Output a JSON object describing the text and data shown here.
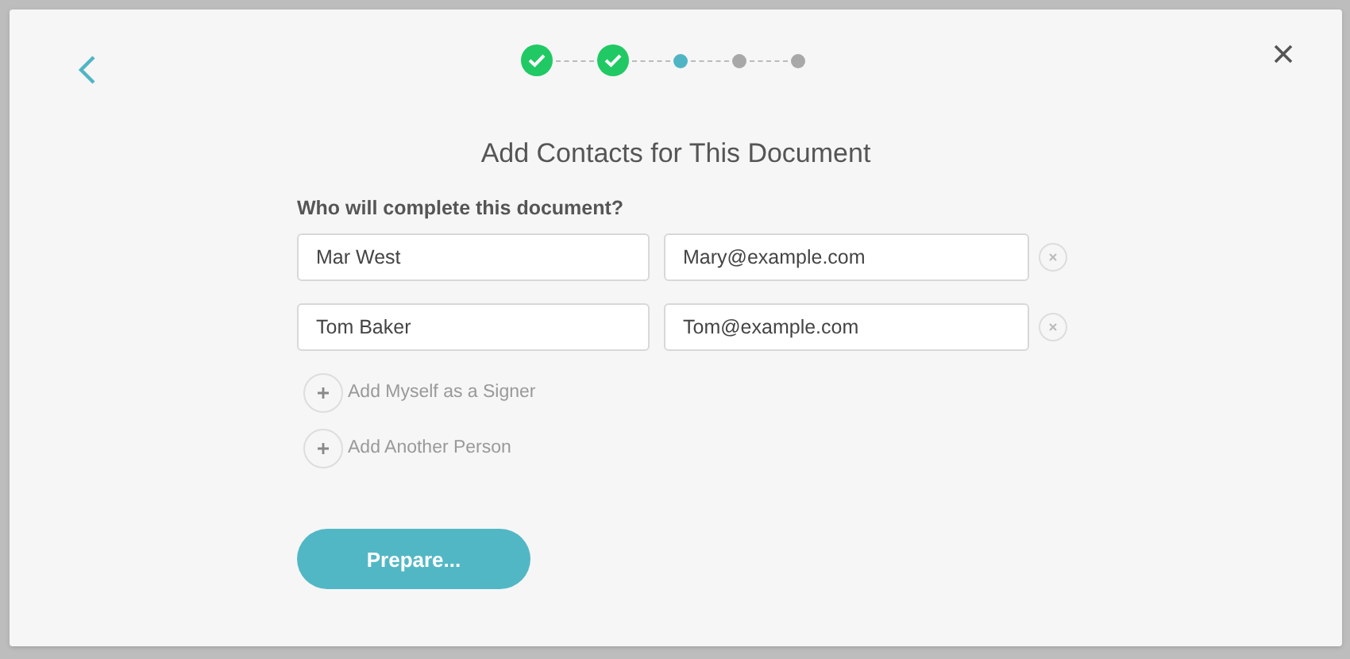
{
  "steps": [
    {
      "completed": true,
      "selected": false
    },
    {
      "completed": true,
      "selected": false
    },
    {
      "completed": false,
      "selected": true
    },
    {
      "completed": false,
      "selected": false
    },
    {
      "completed": false,
      "selected": false
    }
  ],
  "title": "Add Contacts for This Document",
  "question": "Who will complete this document?",
  "contacts": [
    {
      "name": "Mar West",
      "email": "Mary@example.com"
    },
    {
      "name": "Tom Baker",
      "email": "Tom@example.com"
    }
  ],
  "add_actions": [
    "Add Myself as a Signer",
    "Add Another Person"
  ],
  "primary_button": "Prepare..."
}
